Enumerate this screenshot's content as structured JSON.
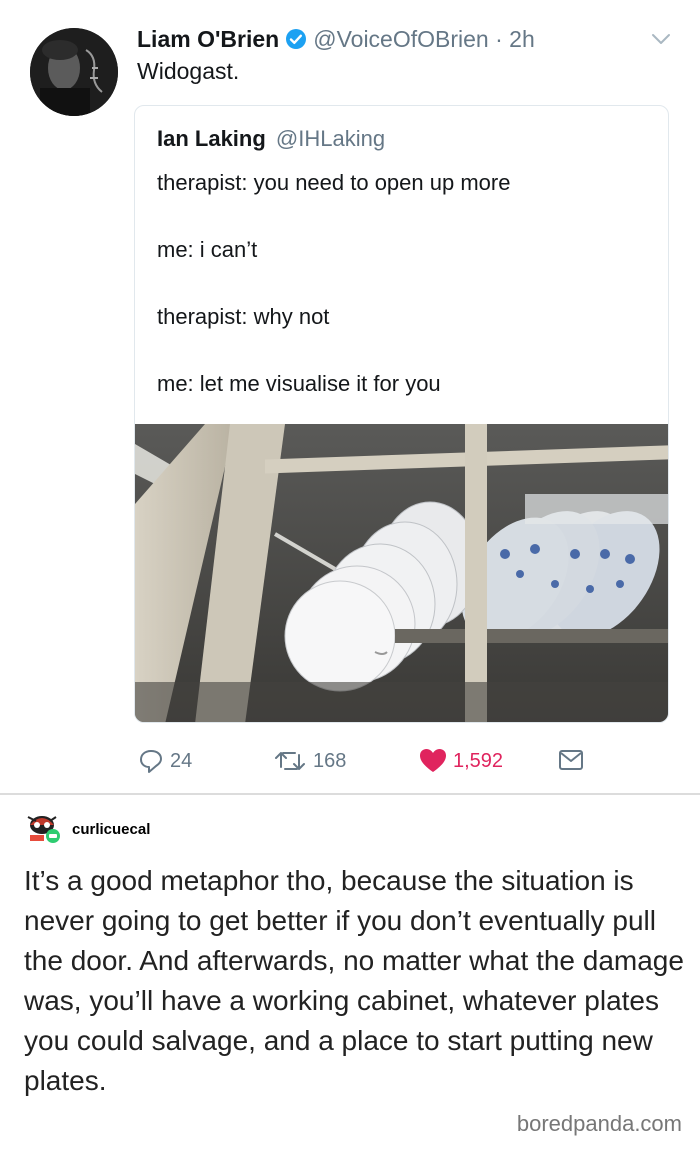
{
  "tweet": {
    "author_name": "Liam O'Brien",
    "handle_time": "@VoiceOfOBrien · 2h",
    "text": "Widogast.",
    "quoted": {
      "name": "Ian Laking",
      "handle": "@IHLaking",
      "lines": [
        "therapist: you need to open up more",
        "me: i can’t",
        "therapist: why not",
        "me: let me visualise it for you"
      ]
    },
    "actions": {
      "replies": "24",
      "retweets": "168",
      "likes": "1,592"
    },
    "colors": {
      "like": "#e0245e",
      "verified": "#1da1f2",
      "muted": "#657786"
    }
  },
  "reply": {
    "username": "curlicuecal",
    "text": "It’s a good metaphor tho, because the situation is never going to get better if you don’t eventually pull the door. And afterwards, no matter what the damage was, you’ll have a working cabinet, whatever plates you could salvage, and a place to start putting new plates."
  },
  "watermark": "boredpanda.com",
  "icons": [
    "verified-icon",
    "chevron-down-icon",
    "reply-icon",
    "retweet-icon",
    "heart-icon",
    "dm-icon"
  ]
}
